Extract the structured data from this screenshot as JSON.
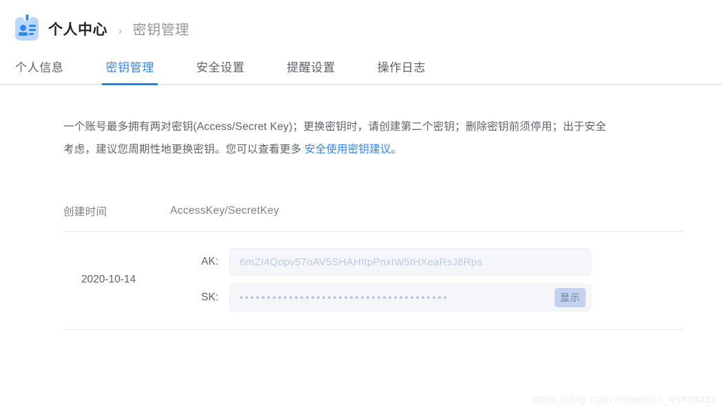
{
  "breadcrumb": {
    "icon": "id-badge-icon",
    "root": "个人中心",
    "separator": "›",
    "leaf": "密钥管理"
  },
  "tabs": [
    {
      "label": "个人信息",
      "active": false
    },
    {
      "label": "密钥管理",
      "active": true
    },
    {
      "label": "安全设置",
      "active": false
    },
    {
      "label": "提醒设置",
      "active": false
    },
    {
      "label": "操作日志",
      "active": false
    }
  ],
  "description": {
    "part1": "一个账号最多拥有两对密钥(Access/Secret Key)；更换密钥时，请创建第二个密钥；删除密钥前须停用；出于安全考虑，建议您周期性地更换密钥。您可以查看更多 ",
    "link": "安全使用密钥建议",
    "part2": "。"
  },
  "table": {
    "headers": {
      "time": "创建时间",
      "keys": "AccessKey/SecretKey"
    },
    "rows": [
      {
        "created": "2020-10-14",
        "ak_label": "AK:",
        "ak_value": "6mZI4Qopv57oAV5SHAHItpPnxIW5tHXeaRsJ8Rps",
        "sk_label": "SK:",
        "sk_masked_count": 38,
        "sk_show_button": "显示"
      }
    ]
  },
  "watermark": "https://blog.csdn.net/weixin_45839321",
  "colors": {
    "accent": "#2f86f6",
    "tab_underline": "#1488f0",
    "icon_bg": "#b9d8fb",
    "field_bg": "#f4f6fa",
    "show_btn_bg": "#c3d2f0"
  }
}
